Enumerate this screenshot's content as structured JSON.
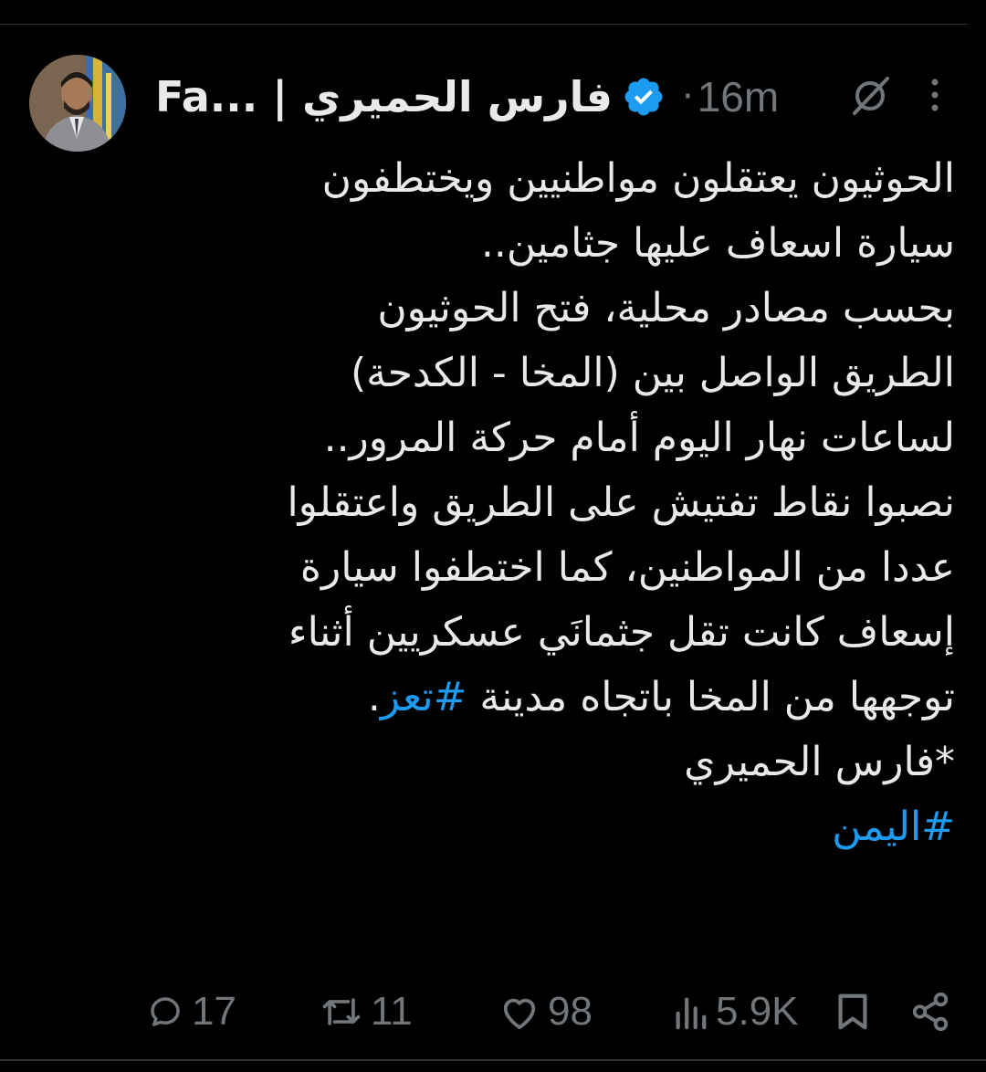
{
  "tweet": {
    "display_name": "Fa... | فارس الحميري",
    "verified": true,
    "separator": "·",
    "timestamp": "16m",
    "text_lines": [
      "الحوثيون يعتقلون مواطنيين ويختطفون",
      "سيارة اسعاف عليها جثامين..",
      "بحسب مصادر محلية، فتح الحوثيون",
      "الطريق الواصل بين (المخا - الكدحة)",
      "لساعات نهار اليوم أمام حركة المرور..",
      "نصبوا نقاط تفتيش على الطريق واعتقلوا",
      "عددا من المواطنين، كما اختطفوا سيارة",
      "إسعاف كانت تقل جثمانَي عسكريين أثناء"
    ],
    "last_line_prefix": "توجهها من المخا باتجاه مدينة ",
    "hashtag_taiz": "#تعز",
    "last_line_suffix": ".",
    "signature": "*فارس الحميري",
    "hashtag_yemen": "#اليمن"
  },
  "actions": {
    "replies": "17",
    "reposts": "11",
    "likes": "98",
    "views": "5.9K"
  },
  "colors": {
    "background": "#000000",
    "text": "#e7e9ea",
    "muted": "#71767b",
    "accent": "#1d9bf0",
    "divider": "#2f3336"
  },
  "icons": [
    "verified-badge-icon",
    "grok-icon",
    "more-options-icon",
    "reply-icon",
    "repost-icon",
    "like-icon",
    "views-icon",
    "bookmark-icon",
    "share-icon"
  ]
}
